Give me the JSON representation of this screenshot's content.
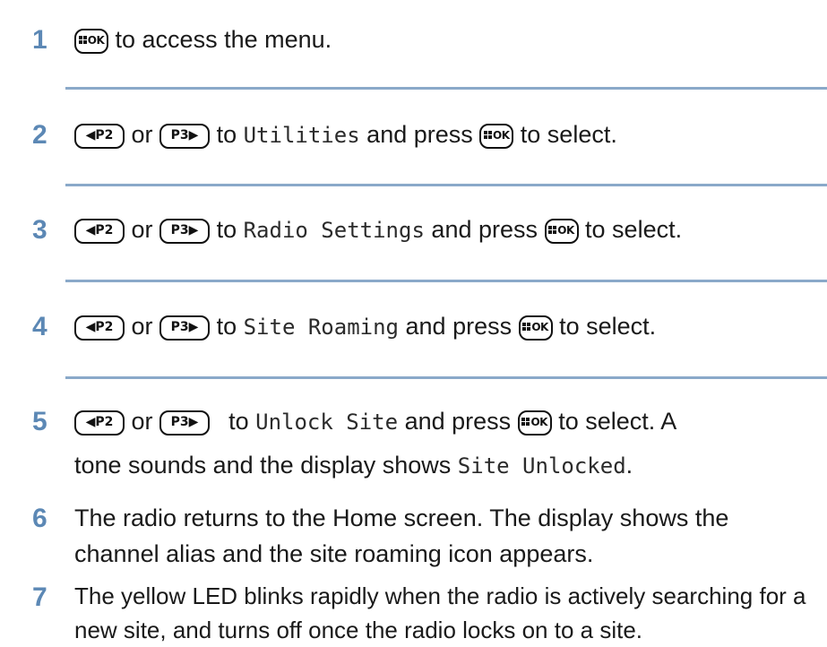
{
  "steps": [
    {
      "number": "1",
      "parts": {
        "t1": "to access the menu."
      }
    },
    {
      "number": "2",
      "parts": {
        "or": "or",
        "to": "to",
        "menu_item": "Utilities",
        "and_press": "and press",
        "to_select": "to select."
      }
    },
    {
      "number": "3",
      "parts": {
        "or": "or",
        "to": "to",
        "menu_item": "Radio Settings",
        "and_press": "and press",
        "to_select": "to select."
      }
    },
    {
      "number": "4",
      "parts": {
        "or": "or",
        "to": "to",
        "menu_item": "Site Roaming",
        "and_press": "and press",
        "to_select": "to select."
      }
    },
    {
      "number": "5",
      "parts": {
        "or": "or",
        "to": "to",
        "menu_item": "Unlock Site",
        "and_press": "and press",
        "to_select": "to select. A",
        "line2_text": "tone sounds and the display shows",
        "line2_mono": "Site Unlocked",
        "line2_end": "."
      }
    },
    {
      "number": "6",
      "text": "The radio returns to the Home screen. The display shows the channel alias and the site roaming icon appears."
    },
    {
      "number": "7",
      "text": "The yellow LED blinks rapidly when the radio is actively searching for a new site, and turns off once the radio locks on to a site."
    }
  ],
  "keys": {
    "ok": "OK",
    "p2": "P2",
    "p3": "P3",
    "left_arrow": "◀",
    "right_arrow": "▶"
  },
  "colors": {
    "step_number": "#5c88b5",
    "divider": "#8aa9c9"
  },
  "icons": [
    "menu-ok-key-icon",
    "p2-left-key-icon",
    "p3-right-key-icon"
  ]
}
